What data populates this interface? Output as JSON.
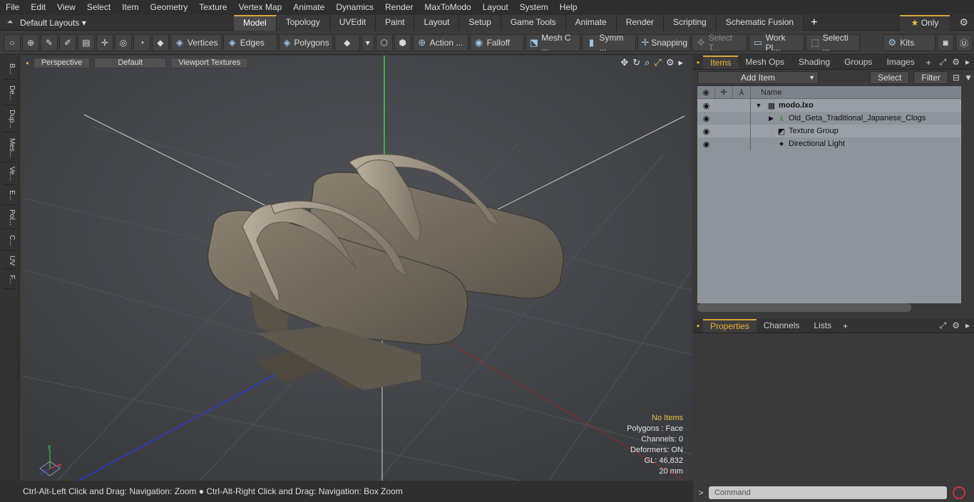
{
  "menu": [
    "File",
    "Edit",
    "View",
    "Select",
    "Item",
    "Geometry",
    "Texture",
    "Vertex Map",
    "Animate",
    "Dynamics",
    "Render",
    "MaxToModo",
    "Layout",
    "System",
    "Help"
  ],
  "layout": {
    "default_layouts": "Default Layouts",
    "tabs": [
      "Model",
      "Topology",
      "UVEdit",
      "Paint",
      "Layout",
      "Setup",
      "Game Tools",
      "Animate",
      "Render",
      "Scripting",
      "Schematic Fusion"
    ],
    "active_tab": "Model",
    "only_label": "Only"
  },
  "toolbar": {
    "vertices": "Vertices",
    "edges": "Edges",
    "polygons": "Polygons",
    "action": "Action ...",
    "falloff": "Falloff",
    "mesh": "Mesh C ...",
    "symm": "Symm ...",
    "snapping": "Snapping",
    "select_t": "Select T...",
    "work_pl": "Work Pl...",
    "selecti": "Selecti ...",
    "kits": "Kits"
  },
  "left_strip": [
    "B...",
    "De...",
    "Dup...",
    "Mes...",
    "Ve...",
    "E...",
    "Pol...",
    "C...",
    "UV",
    "F..."
  ],
  "viewport": {
    "perspective": "Perspective",
    "default": "Default",
    "textures": "Viewport Textures",
    "hud": {
      "no_items": "No Items",
      "polygons": "Polygons : Face",
      "channels": "Channels: 0",
      "deformers": "Deformers: ON",
      "gl": "GL: 46,832",
      "units": "20 mm"
    }
  },
  "status": "Ctrl-Alt-Left Click and Drag: Navigation: Zoom ● Ctrl-Alt-Right Click and Drag: Navigation: Box Zoom",
  "items_panel": {
    "tabs": [
      "Items",
      "Mesh Ops",
      "Shading",
      "Groups",
      "Images"
    ],
    "active_tab": "Items",
    "add_item": "Add Item",
    "select": "Select",
    "filter": "Filter",
    "name_col": "Name",
    "tree": [
      {
        "label": "modo.lxo",
        "icon": "scene-icon",
        "expander": "▼",
        "bold": true
      },
      {
        "label": "Old_Geta_Traditional_Japanese_Clogs",
        "icon": "mesh-icon",
        "expander": "▶",
        "bold": false
      },
      {
        "label": "Texture Group",
        "icon": "texture-icon",
        "expander": "",
        "bold": false
      },
      {
        "label": "Directional Light",
        "icon": "light-icon",
        "expander": "",
        "bold": false
      }
    ]
  },
  "props_panel": {
    "tabs": [
      "Properties",
      "Channels",
      "Lists"
    ],
    "active_tab": "Properties"
  },
  "command": {
    "placeholder": "Command"
  },
  "colors": {
    "accent": "#d6a43b",
    "viewport_bg": "#46494d",
    "tree_bg": "#8e949c"
  }
}
